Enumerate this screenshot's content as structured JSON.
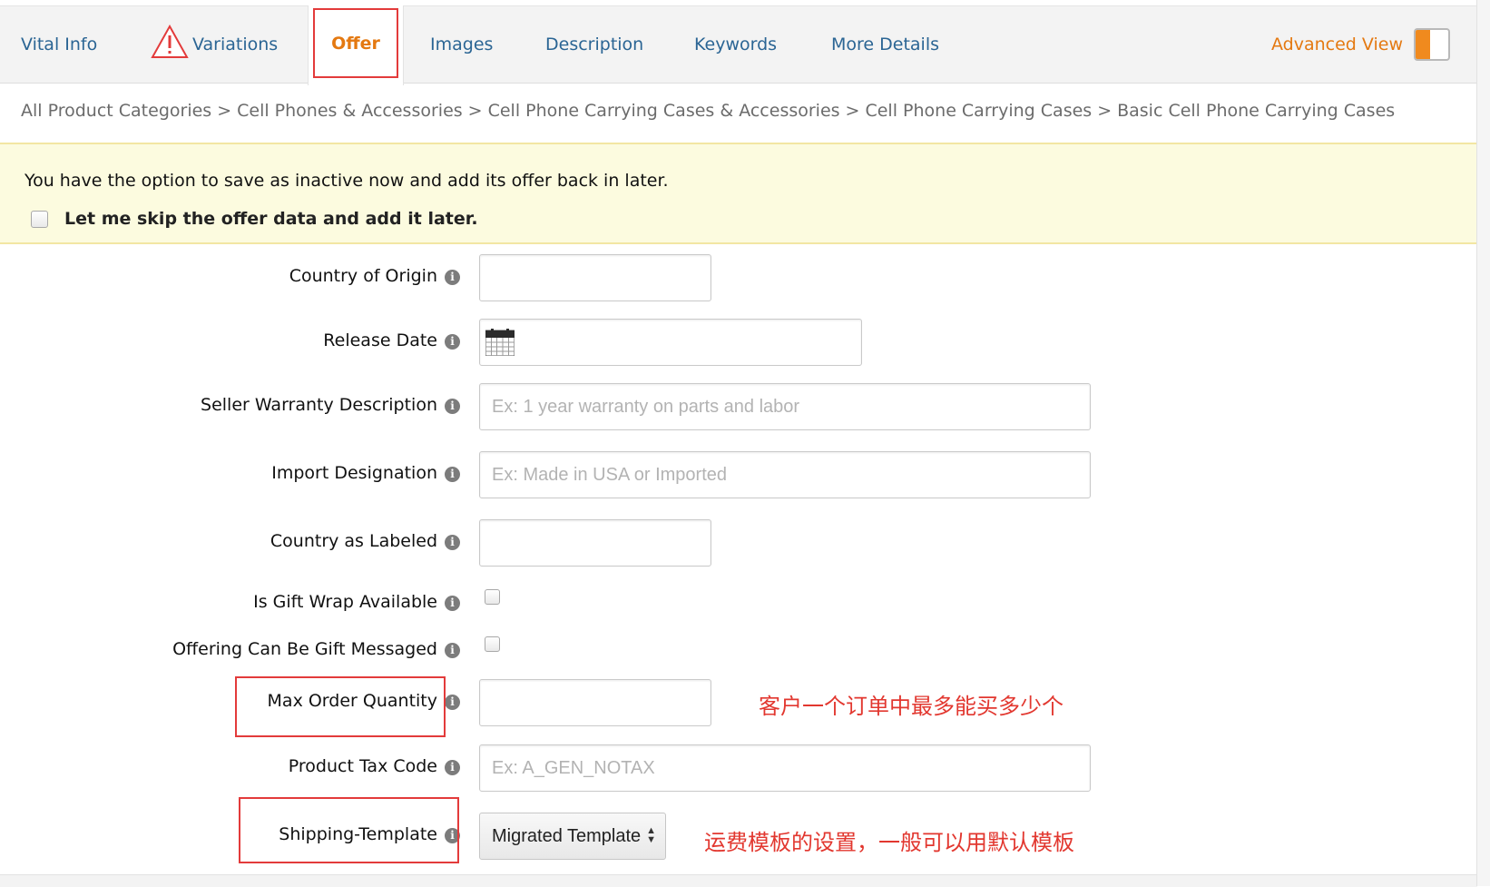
{
  "tabs": {
    "vital_info": "Vital Info",
    "variations": "Variations",
    "offer": "Offer",
    "images": "Images",
    "description": "Description",
    "keywords": "Keywords",
    "more_details": "More Details"
  },
  "advanced_view": {
    "label": "Advanced View",
    "enabled": true
  },
  "breadcrumb": {
    "items": [
      "All Product Categories",
      "Cell Phones & Accessories",
      "Cell Phone Carrying Cases & Accessories",
      "Cell Phone Carrying Cases",
      "Basic Cell Phone Carrying Cases"
    ],
    "separator": ">"
  },
  "alert": {
    "message": "You have the option to save as inactive now and add its offer back in later.",
    "skip_label": "Let me skip the offer data and add it later.",
    "skip_checked": false
  },
  "form": {
    "country_of_origin": {
      "label": "Country of Origin",
      "value": ""
    },
    "release_date": {
      "label": "Release Date",
      "value": ""
    },
    "seller_warranty": {
      "label": "Seller Warranty Description",
      "placeholder": "Ex: 1 year warranty on parts and labor"
    },
    "import_designation": {
      "label": "Import Designation",
      "placeholder": "Ex: Made in USA or Imported"
    },
    "country_as_labeled": {
      "label": "Country as Labeled",
      "value": ""
    },
    "gift_wrap": {
      "label": "Is Gift Wrap Available",
      "checked": false
    },
    "gift_message": {
      "label": "Offering Can Be Gift Messaged",
      "checked": false
    },
    "max_order_quantity": {
      "label": "Max Order Quantity",
      "value": "",
      "annotation": "客户一个订单中最多能买多少个"
    },
    "product_tax_code": {
      "label": "Product Tax Code",
      "placeholder": "Ex: A_GEN_NOTAX"
    },
    "shipping_template": {
      "label": "Shipping-Template",
      "selected": "Migrated Template",
      "annotation": "运费模板的设置，一般可以用默认模板"
    }
  },
  "info_icon_glyph": "i",
  "colors": {
    "accent": "#e47911",
    "link": "#2b6594",
    "annotation_red": "#e2372f",
    "alert_bg": "#fcfbdf"
  },
  "icons": {
    "warning": "warning-triangle-icon",
    "calendar": "calendar-icon",
    "info": "info-icon"
  }
}
